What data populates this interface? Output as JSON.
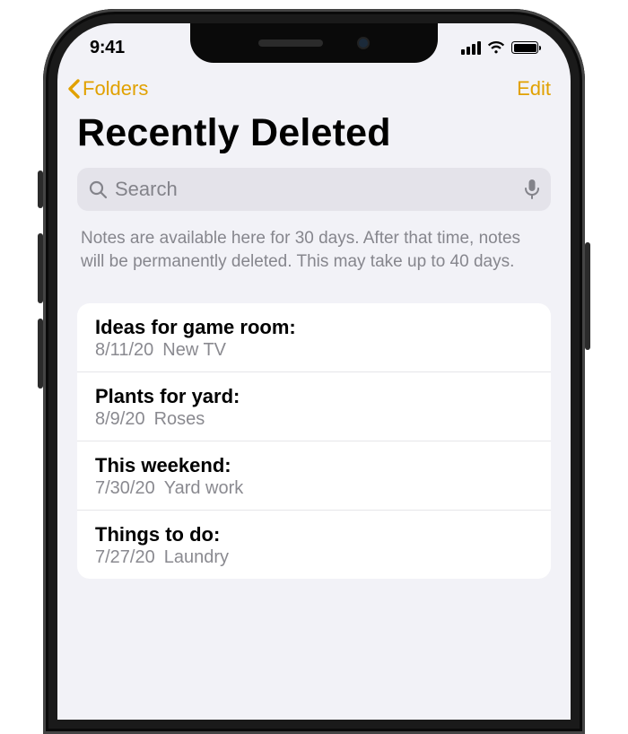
{
  "status": {
    "time": "9:41"
  },
  "nav": {
    "back_label": "Folders",
    "edit_label": "Edit"
  },
  "title": "Recently Deleted",
  "search": {
    "placeholder": "Search"
  },
  "info": "Notes are available here for 30 days. After that time, notes will be permanently deleted. This may take up to 40 days.",
  "notes": [
    {
      "title": "Ideas for game room:",
      "date": "8/11/20",
      "preview": "New TV"
    },
    {
      "title": "Plants for yard:",
      "date": "8/9/20",
      "preview": "Roses"
    },
    {
      "title": "This weekend:",
      "date": "7/30/20",
      "preview": "Yard work"
    },
    {
      "title": "Things to do:",
      "date": "7/27/20",
      "preview": "Laundry"
    }
  ],
  "colors": {
    "accent": "#e1a100",
    "bg": "#f2f2f7"
  }
}
